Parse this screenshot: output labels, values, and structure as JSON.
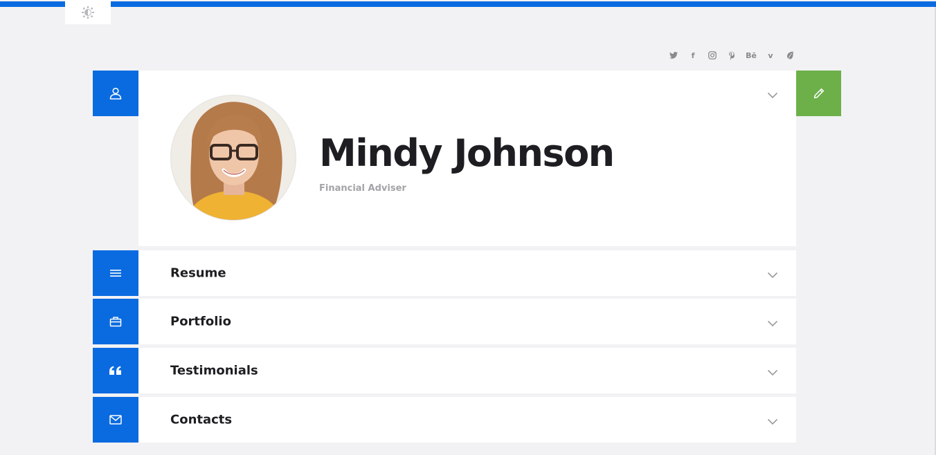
{
  "theme_toggle": {
    "icon": "brightness-icon"
  },
  "social_links": [
    {
      "name": "twitter-icon",
      "glyph": ""
    },
    {
      "name": "facebook-icon",
      "glyph": "f"
    },
    {
      "name": "instagram-icon",
      "glyph": ""
    },
    {
      "name": "pinterest-icon",
      "glyph": ""
    },
    {
      "name": "behance-icon",
      "glyph": "Bē"
    },
    {
      "name": "vimeo-icon",
      "glyph": "v"
    },
    {
      "name": "leaf-icon",
      "glyph": ""
    }
  ],
  "profile": {
    "name": "Mindy Johnson",
    "title": "Financial Adviser"
  },
  "sections": [
    {
      "label": "Resume",
      "icon": "menu-lines-icon"
    },
    {
      "label": "Portfolio",
      "icon": "briefcase-icon"
    },
    {
      "label": "Testimonials",
      "icon": "quote-icon"
    },
    {
      "label": "Contacts",
      "icon": "envelope-icon"
    }
  ],
  "colors": {
    "accent": "#0a6be0",
    "edit": "#6db04a",
    "background": "#f2f2f4"
  }
}
